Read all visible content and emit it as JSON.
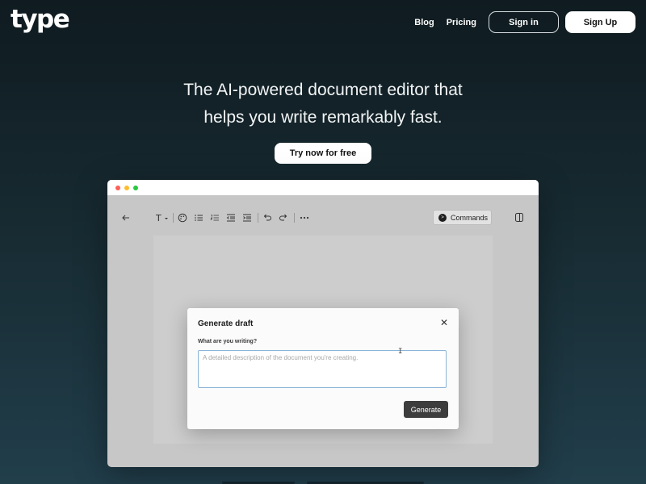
{
  "header": {
    "logo": "type",
    "nav": [
      "Blog",
      "Pricing"
    ],
    "signin_label": "Sign in",
    "signup_label": "Sign Up"
  },
  "hero": {
    "line1": "The AI-powered document editor that",
    "line2": "helps you write remarkably fast.",
    "cta_label": "Try now for free"
  },
  "editor": {
    "window_dots": [
      "#ff5f57",
      "#febc2e",
      "#28c840"
    ],
    "toolbar": {
      "back_icon": "arrow-left-icon",
      "text_style_icon": "text-style-icon",
      "text_style_glyph": "T",
      "icons": [
        "palette-icon",
        "bullet-list-icon",
        "numbered-list-icon",
        "outdent-icon",
        "indent-icon",
        "undo-icon",
        "redo-icon",
        "more-icon"
      ],
      "commands_label": "Commands",
      "sidebar_toggle_icon": "sidebar-toggle-icon"
    },
    "modal": {
      "title": "Generate draft",
      "label": "What are you writing?",
      "placeholder": "A detailed description of the document you're creating.",
      "value": "",
      "button_label": "Generate"
    }
  },
  "colors": {
    "background_top": "#0f1b20",
    "background_bottom": "#213e4b",
    "generate_button": "#3d3d3d",
    "textarea_border": "#8ab4d8"
  }
}
